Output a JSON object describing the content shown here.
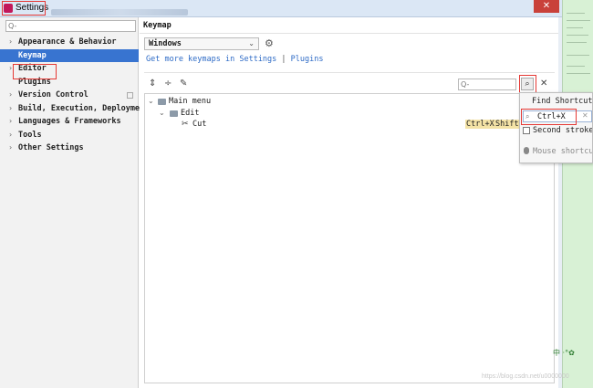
{
  "window": {
    "title": "Settings",
    "close_glyph": "✕"
  },
  "sidebar": {
    "search_placeholder": "Q-",
    "items": [
      {
        "label": "Appearance & Behavior",
        "expandable": true
      },
      {
        "label": "Keymap",
        "expandable": false,
        "selected": true
      },
      {
        "label": "Editor",
        "expandable": true
      },
      {
        "label": "Plugins",
        "expandable": false
      },
      {
        "label": "Version Control",
        "expandable": true
      },
      {
        "label": "Build, Execution, Deployment",
        "expandable": true
      },
      {
        "label": "Languages & Frameworks",
        "expandable": true
      },
      {
        "label": "Tools",
        "expandable": true
      },
      {
        "label": "Other Settings",
        "expandable": true
      }
    ]
  },
  "main": {
    "title": "Keymap",
    "keymap_select": "Windows",
    "link_more": "Get more keymaps in Settings",
    "link_sep": "|",
    "link_plugins": "Plugins",
    "filter_placeholder": "Q-"
  },
  "keymap_tree": {
    "root": "Main menu",
    "group": "Edit",
    "action": "Cut",
    "shortcuts": [
      "Ctrl+X",
      "Shift+"
    ]
  },
  "find_popup": {
    "title": "Find Shortcut",
    "value": "Ctrl+X",
    "second_stroke_label": "Second stroke",
    "mouse_shortcut_label": "Mouse shortcut"
  },
  "desktop": {
    "ime_label": "中",
    "watermark": "https://blog.csdn.net/u0000000"
  },
  "colors": {
    "selection": "#3874d0",
    "link": "#2e6bc6",
    "highlight": "#f4e3a6",
    "annotation": "#e53935"
  }
}
